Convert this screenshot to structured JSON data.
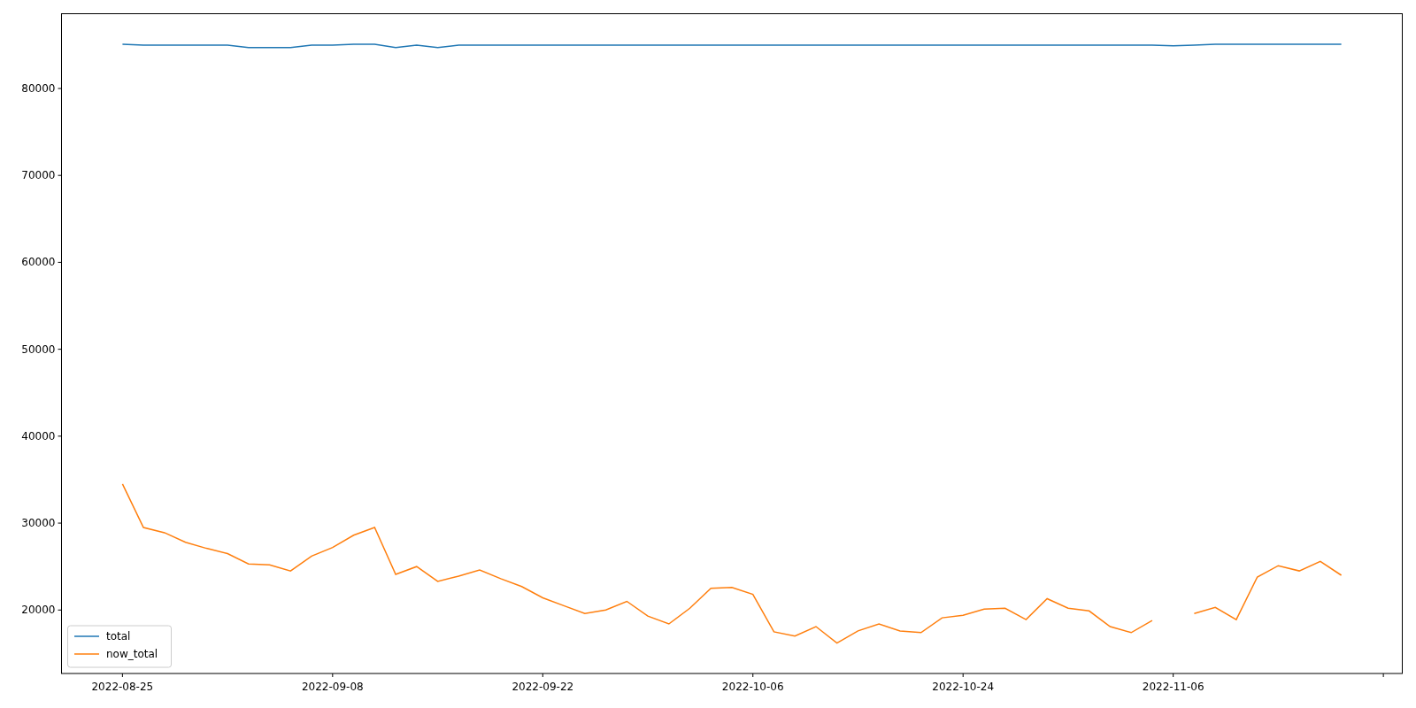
{
  "chart_data": {
    "type": "line",
    "categories": [
      "2022-08-25",
      null,
      null,
      null,
      null,
      null,
      null,
      null,
      null,
      null,
      "2022-09-08",
      null,
      null,
      null,
      null,
      null,
      null,
      null,
      null,
      null,
      "2022-09-22",
      null,
      null,
      null,
      null,
      null,
      null,
      null,
      null,
      null,
      "2022-10-06",
      null,
      null,
      null,
      null,
      null,
      null,
      null,
      null,
      null,
      "2022-10-24",
      null,
      null,
      null,
      null,
      null,
      null,
      null,
      null,
      null,
      "2022-11-06",
      null,
      null,
      null,
      null,
      null,
      null,
      null,
      null
    ],
    "series": [
      {
        "name": "total",
        "color": "#1f77b4",
        "values": [
          85100,
          85000,
          85000,
          85000,
          85000,
          85000,
          84700,
          84700,
          84700,
          85000,
          85000,
          85100,
          85100,
          84700,
          85000,
          84700,
          85000,
          85000,
          85000,
          85000,
          85000,
          85000,
          85000,
          85000,
          85000,
          85000,
          85000,
          85000,
          85000,
          85000,
          85000,
          85000,
          85000,
          85000,
          85000,
          85000,
          85000,
          85000,
          85000,
          85000,
          85000,
          85000,
          85000,
          85000,
          85000,
          85000,
          85000,
          85000,
          85000,
          85000,
          84900,
          85000,
          85100,
          85100,
          85100,
          85100,
          85100,
          85100,
          85100
        ]
      },
      {
        "name": "now_total",
        "color": "#ff7f0e",
        "values": [
          34500,
          29500,
          28900,
          27800,
          27100,
          26500,
          25300,
          25200,
          24500,
          26200,
          27200,
          28600,
          29500,
          24100,
          25000,
          23300,
          23900,
          24600,
          23600,
          22700,
          21400,
          20500,
          19600,
          20000,
          21000,
          19300,
          18400,
          20200,
          22500,
          22600,
          21800,
          17500,
          17000,
          18100,
          16200,
          17600,
          18400,
          17600,
          17400,
          19100,
          19400,
          20100,
          20200,
          18900,
          21300,
          20200,
          19900,
          18100,
          17400,
          18800,
          null,
          19600,
          20300,
          18900,
          23800,
          25100,
          24500,
          25600,
          24000
        ]
      }
    ],
    "legend": "lower left",
    "ylim": [
      12700,
      88600
    ],
    "yticks": [
      20000,
      30000,
      40000,
      50000,
      60000,
      70000,
      80000
    ]
  }
}
